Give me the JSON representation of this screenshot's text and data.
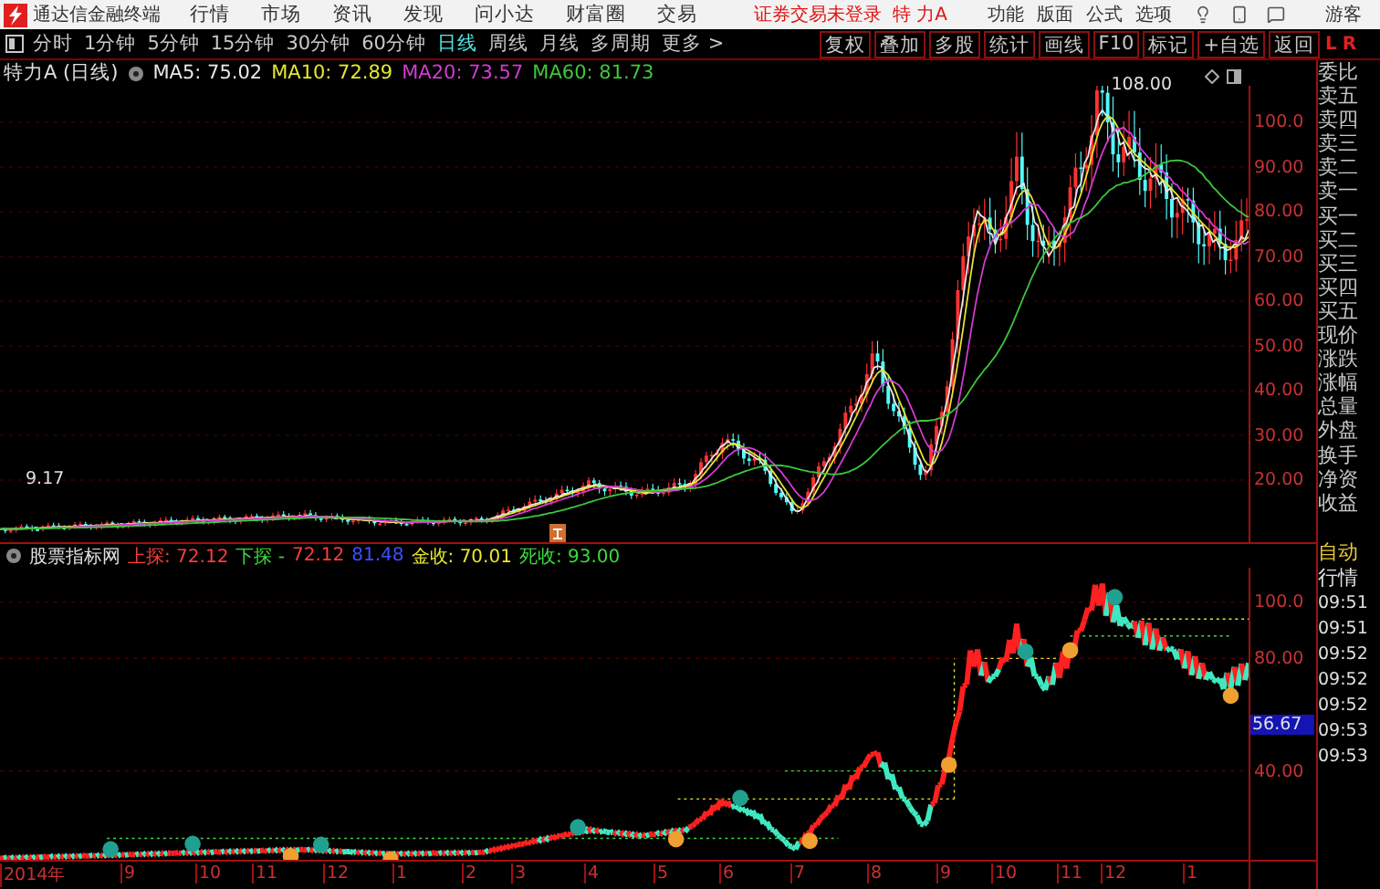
{
  "title_bar": {
    "app_name": "通达信金融终端",
    "menus": [
      "行情",
      "市场",
      "资讯",
      "发现",
      "问小达",
      "财富圈",
      "交易"
    ],
    "status": "证券交易未登录",
    "stock": "特 力A",
    "right_menus": [
      "功能",
      "版面",
      "公式",
      "选项"
    ],
    "user": "游客"
  },
  "periods": [
    {
      "label": "分时",
      "selected": false
    },
    {
      "label": "1分钟",
      "selected": false
    },
    {
      "label": "5分钟",
      "selected": false
    },
    {
      "label": "15分钟",
      "selected": false
    },
    {
      "label": "30分钟",
      "selected": false
    },
    {
      "label": "60分钟",
      "selected": false
    },
    {
      "label": "日线",
      "selected": true
    },
    {
      "label": "周线",
      "selected": false
    },
    {
      "label": "月线",
      "selected": false
    },
    {
      "label": "多周期",
      "selected": false
    },
    {
      "label": "更多 >",
      "selected": false
    }
  ],
  "toolbar": [
    "复权",
    "叠加",
    "多股",
    "统计",
    "画线",
    "F10",
    "标记",
    "+自选",
    "返回"
  ],
  "panel_header": {
    "left": "L",
    "right": "R"
  },
  "info": {
    "stock": "特力A (日线)",
    "ma": [
      {
        "label": "MA5: 75.02",
        "color": "#e8e8e8"
      },
      {
        "label": "MA10: 72.89",
        "color": "#e6e632"
      },
      {
        "label": "MA20: 73.57",
        "color": "#d23cd2"
      },
      {
        "label": "MA60: 81.73",
        "color": "#3cc83c"
      }
    ]
  },
  "main_chart": {
    "yticks": [
      "100.0",
      "90.00",
      "80.00",
      "70.00",
      "60.00",
      "50.00",
      "40.00",
      "30.00",
      "20.00"
    ],
    "high_label": "108.00",
    "low_label": "9.17"
  },
  "indicator": {
    "name": "股票指标网",
    "items": [
      {
        "text": "上探: 72.12",
        "color": "#ff3c3c"
      },
      {
        "text": "下探 -",
        "color": "#3cdc3c"
      },
      {
        "text": "72.12",
        "color": "#ff3c3c"
      },
      {
        "text": "81.48",
        "color": "#3c50ff"
      },
      {
        "text": "金收: 70.01",
        "color": "#e6e632"
      },
      {
        "text": "死收: 93.00",
        "color": "#3cdc3c"
      }
    ],
    "yticks": [
      "100.0",
      "80.00",
      "40.00"
    ],
    "current": "56.67"
  },
  "xaxis": [
    "2014年",
    "9",
    "10",
    "11",
    "12",
    "1",
    "2",
    "3",
    "4",
    "5",
    "6",
    "7",
    "8",
    "9",
    "10",
    "11",
    "12",
    "1"
  ],
  "quote_panel": {
    "fields": [
      "委比",
      "卖五",
      "卖四",
      "卖三",
      "卖二",
      "卖一",
      "买一",
      "买二",
      "买三",
      "买四",
      "买五",
      "现价",
      "涨跌",
      "涨幅",
      "总量",
      "外盘",
      "换手",
      "净资",
      "收益"
    ],
    "tabs": [
      {
        "label": "自动",
        "selected": true
      },
      {
        "label": "行情",
        "selected": false
      }
    ],
    "times": [
      "09:51",
      "09:51",
      "09:52",
      "09:52",
      "09:52",
      "09:53",
      "09:53"
    ]
  }
}
